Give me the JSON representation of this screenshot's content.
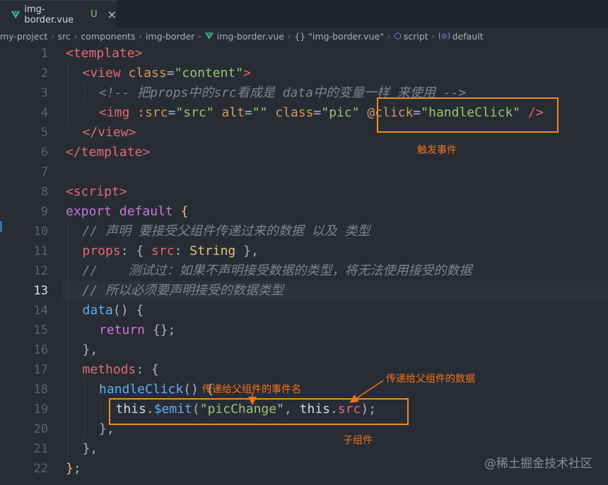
{
  "tab": {
    "filename": "img-border.vue",
    "status": "U",
    "close_glyph": "×"
  },
  "breadcrumb": [
    {
      "type": "text",
      "label": "my-project"
    },
    {
      "type": "text",
      "label": "src"
    },
    {
      "type": "text",
      "label": "components"
    },
    {
      "type": "text",
      "label": "img-border"
    },
    {
      "type": "vue",
      "label": "img-border.vue"
    },
    {
      "type": "braces",
      "label": "\"img-border.vue\""
    },
    {
      "type": "cube",
      "label": "script"
    },
    {
      "type": "field",
      "label": "default"
    }
  ],
  "editor": {
    "active_line": 13,
    "lines": [
      {
        "n": 1,
        "indent": 0,
        "tokens": [
          [
            "tag",
            "<template"
          ],
          [
            "tag",
            ">"
          ]
        ]
      },
      {
        "n": 2,
        "indent": 1,
        "tokens": [
          [
            "tag",
            "<view"
          ],
          [
            "pun",
            " "
          ],
          [
            "attr",
            "class"
          ],
          [
            "pun",
            "="
          ],
          [
            "str",
            "\"content\""
          ],
          [
            "tag",
            ">"
          ]
        ]
      },
      {
        "n": 3,
        "indent": 2,
        "tokens": [
          [
            "cmt",
            "<!-- 把props中的src看成是 data中的变量一样 来使用 -->"
          ]
        ]
      },
      {
        "n": 4,
        "indent": 2,
        "tokens": [
          [
            "tag",
            "<img"
          ],
          [
            "pun",
            " "
          ],
          [
            "attr",
            ":src"
          ],
          [
            "pun",
            "="
          ],
          [
            "str",
            "\"src\""
          ],
          [
            "pun",
            " "
          ],
          [
            "attr",
            "alt"
          ],
          [
            "pun",
            "="
          ],
          [
            "str",
            "\"\""
          ],
          [
            "pun",
            " "
          ],
          [
            "attr",
            "class"
          ],
          [
            "pun",
            "="
          ],
          [
            "str",
            "\"pic\""
          ],
          [
            "pun",
            " "
          ],
          [
            "attr",
            "@click"
          ],
          [
            "pun",
            "="
          ],
          [
            "str",
            "\"handleClick\""
          ],
          [
            "pun",
            " "
          ],
          [
            "tag",
            "/>"
          ]
        ]
      },
      {
        "n": 5,
        "indent": 1,
        "tokens": [
          [
            "tag",
            "</view>"
          ]
        ]
      },
      {
        "n": 6,
        "indent": 0,
        "tokens": [
          [
            "tag",
            "</template>"
          ]
        ]
      },
      {
        "n": 7,
        "indent": 0,
        "tokens": []
      },
      {
        "n": 8,
        "indent": 0,
        "tokens": [
          [
            "tag",
            "<script"
          ],
          [
            "tag",
            ">"
          ]
        ]
      },
      {
        "n": 9,
        "indent": 0,
        "tokens": [
          [
            "kw",
            "export"
          ],
          [
            "pun",
            " "
          ],
          [
            "kw",
            "default"
          ],
          [
            "pun",
            " "
          ],
          [
            "brk",
            "{"
          ]
        ]
      },
      {
        "n": 10,
        "indent": 1,
        "tokens": [
          [
            "cmt",
            "// 声明 要接受父组件传递过来的数据 以及 类型"
          ]
        ]
      },
      {
        "n": 11,
        "indent": 1,
        "tokens": [
          [
            "prop",
            "props"
          ],
          [
            "pun",
            ": { "
          ],
          [
            "prop",
            "src"
          ],
          [
            "pun",
            ": "
          ],
          [
            "type",
            "String"
          ],
          [
            "pun",
            " },"
          ]
        ]
      },
      {
        "n": 12,
        "indent": 1,
        "tokens": [
          [
            "cmt",
            "//    测试过：如果不声明接受数据的类型，将无法使用接受的数据"
          ]
        ]
      },
      {
        "n": 13,
        "indent": 1,
        "tokens": [
          [
            "cmt",
            "// 所以必须要声明接受的数据类型"
          ]
        ]
      },
      {
        "n": 14,
        "indent": 1,
        "tokens": [
          [
            "fn",
            "data"
          ],
          [
            "pun",
            "() {"
          ]
        ]
      },
      {
        "n": 15,
        "indent": 2,
        "tokens": [
          [
            "kw",
            "return"
          ],
          [
            "pun",
            " {};"
          ]
        ]
      },
      {
        "n": 16,
        "indent": 1,
        "tokens": [
          [
            "pun",
            "},"
          ]
        ]
      },
      {
        "n": 17,
        "indent": 1,
        "tokens": [
          [
            "prop",
            "methods"
          ],
          [
            "pun",
            ": {"
          ]
        ]
      },
      {
        "n": 18,
        "indent": 2,
        "tokens": [
          [
            "fn",
            "handleClick"
          ],
          [
            "pun",
            "() {"
          ]
        ]
      },
      {
        "n": 19,
        "indent": 3,
        "tokens": [
          [
            "plain",
            "this"
          ],
          [
            "pun",
            "."
          ],
          [
            "fn",
            "$emit"
          ],
          [
            "pun",
            "("
          ],
          [
            "str",
            "\"picChange\""
          ],
          [
            "pun",
            ", "
          ],
          [
            "plain",
            "this"
          ],
          [
            "pun",
            "."
          ],
          [
            "prop",
            "src"
          ],
          [
            "pun",
            ");"
          ]
        ]
      },
      {
        "n": 20,
        "indent": 2,
        "tokens": [
          [
            "pun",
            "},"
          ]
        ]
      },
      {
        "n": 21,
        "indent": 1,
        "tokens": [
          [
            "pun",
            "},"
          ]
        ]
      },
      {
        "n": 22,
        "indent": 0,
        "tokens": [
          [
            "brk",
            "}"
          ],
          [
            "pun",
            ";"
          ]
        ]
      }
    ]
  },
  "annotations": {
    "trigger_event": "触发事件",
    "event_name": "传递给父组件的事件名",
    "event_data": "传递给父组件的数据",
    "child_component": "子组件"
  },
  "watermark": "@稀土掘金技术社区",
  "colors": {
    "annotation": "#f0741e",
    "box": "#f08c1e",
    "background": "#282c34"
  }
}
